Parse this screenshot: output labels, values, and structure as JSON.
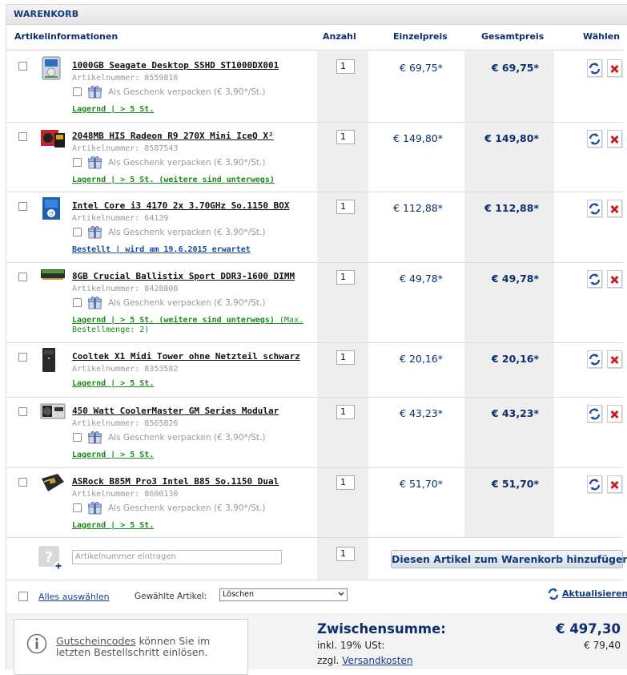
{
  "title": "WARENKORB",
  "columns": {
    "info": "Artikelinformationen",
    "qty": "Anzahl",
    "unit": "Einzelpreis",
    "total": "Gesamtpreis",
    "select": "Wählen"
  },
  "gift_label": "Als Geschenk verpacken (€ 3,90*/St.)",
  "items": [
    {
      "name": "1000GB Seagate Desktop SSHD ST1000DX001",
      "artnr": "Artikelnummer: 8559816",
      "gift": true,
      "stock": "Lagernd | > 5 St.",
      "stock_extra": "",
      "stock_color": "green",
      "qty": "1",
      "unit_price": "€ 69,75*",
      "total_price": "€ 69,75*",
      "thumb_icon": "hard-drive-icon"
    },
    {
      "name": "2048MB HIS Radeon R9 270X Mini IceQ X²",
      "artnr": "Artikelnummer: 8587543",
      "gift": true,
      "stock": "Lagernd | > 5 St. (weitere sind unterwegs)",
      "stock_extra": "",
      "stock_color": "green",
      "qty": "1",
      "unit_price": "€ 149,80*",
      "total_price": "€ 149,80*",
      "thumb_icon": "graphics-card-icon"
    },
    {
      "name": "Intel Core i3 4170 2x 3.70GHz So.1150 BOX",
      "artnr": "Artikelnummer: 64139",
      "gift": true,
      "stock": "Bestellt | wird am 19.6.2015 erwartet",
      "stock_extra": "",
      "stock_color": "blue",
      "qty": "1",
      "unit_price": "€ 112,88*",
      "total_price": "€ 112,88*",
      "thumb_icon": "cpu-box-icon"
    },
    {
      "name": "8GB Crucial Ballistix Sport DDR3-1600 DIMM",
      "artnr": "Artikelnummer: 8428808",
      "gift": true,
      "stock": "Lagernd | > 5 St. (weitere sind unterwegs)",
      "stock_extra": " (Max.",
      "stock_extra2": "Bestellmenge: 2)",
      "stock_color": "green",
      "qty": "1",
      "unit_price": "€ 49,78*",
      "total_price": "€ 49,78*",
      "thumb_icon": "ram-module-icon"
    },
    {
      "name": "Cooltek X1 Midi Tower ohne Netzteil schwarz",
      "artnr": "Artikelnummer: 8353582",
      "gift": false,
      "stock": "Lagernd | > 5 St.",
      "stock_extra": "",
      "stock_color": "green",
      "qty": "1",
      "unit_price": "€ 20,16*",
      "total_price": "€ 20,16*",
      "thumb_icon": "pc-tower-icon"
    },
    {
      "name": "450 Watt CoolerMaster GM Series Modular",
      "artnr": "Artikelnummer: 8565826",
      "gift": true,
      "stock": "Lagernd | > 5 St.",
      "stock_extra": "",
      "stock_color": "green",
      "qty": "1",
      "unit_price": "€ 43,23*",
      "total_price": "€ 43,23*",
      "thumb_icon": "power-supply-icon"
    },
    {
      "name": "ASRock B85M Pro3 Intel B85 So.1150 Dual",
      "artnr": "Artikelnummer: 8600130",
      "gift": true,
      "stock": "Lagernd | > 5 St.",
      "stock_extra": "",
      "stock_color": "green",
      "qty": "1",
      "unit_price": "€ 51,70*",
      "total_price": "€ 51,70*",
      "thumb_icon": "motherboard-icon"
    }
  ],
  "add_row": {
    "placeholder": "Artikelnummer eintragen",
    "qty": "1",
    "button": "Diesen Artikel zum Warenkorb hinzufügen"
  },
  "footer": {
    "select_all": "Alles auswählen",
    "selected_label": "Gewählte Artikel:",
    "selected_value": "Löschen",
    "update": "Aktualisieren"
  },
  "coupon": {
    "link": "Gutscheincodes",
    "text1": " können Sie im",
    "text2": "letzten Bestellschritt einlösen."
  },
  "summary": {
    "subtotal_label": "Zwischensumme:",
    "subtotal_value": "€ 497,30",
    "vat_label": "inkl. 19% USt:",
    "vat_value": "€ 79,40",
    "shipping_prefix": "zzgl. ",
    "shipping_link": "Versandkosten"
  },
  "colors": {
    "accent": "#0b2f6e",
    "stock_green": "#1e8a1e",
    "stock_blue": "#1a4a9a",
    "delete_red": "#d0141a"
  }
}
